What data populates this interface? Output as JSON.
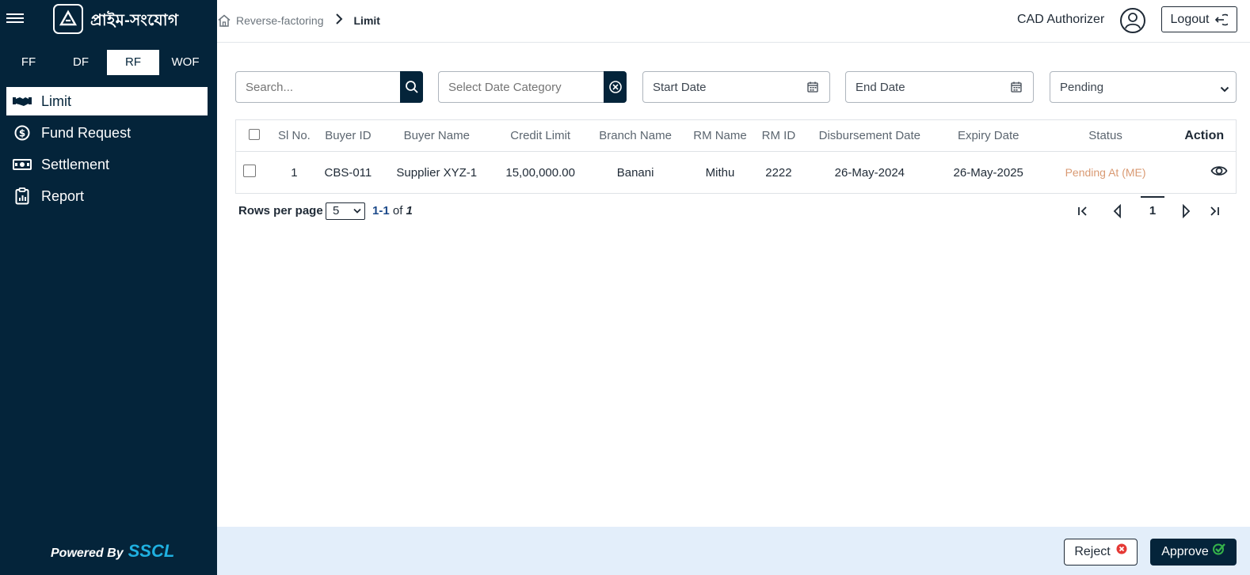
{
  "sidebar": {
    "brand": "প্রাইম-সংযোগ",
    "tabs": [
      {
        "label": "FF",
        "active": false
      },
      {
        "label": "DF",
        "active": false
      },
      {
        "label": "RF",
        "active": true
      },
      {
        "label": "WOF",
        "active": false
      }
    ],
    "nav": [
      {
        "label": "Limit",
        "icon": "handshake-icon",
        "active": true
      },
      {
        "label": "Fund Request",
        "icon": "dollar-circle-icon",
        "active": false
      },
      {
        "label": "Settlement",
        "icon": "cash-icon",
        "active": false
      },
      {
        "label": "Report",
        "icon": "clipboard-icon",
        "active": false
      }
    ],
    "powered_by": "Powered By",
    "powered_brand": "SSCL"
  },
  "header": {
    "breadcrumb": [
      "Reverse-factoring",
      "Limit"
    ],
    "user": "CAD Authorizer",
    "logout": "Logout"
  },
  "filters": {
    "search_placeholder": "Search...",
    "date_category_placeholder": "Select Date Category",
    "start_date": "Start Date",
    "end_date": "End Date",
    "status_selected": "Pending"
  },
  "table": {
    "columns": [
      "Sl No.",
      "Buyer ID",
      "Buyer Name",
      "Credit Limit",
      "Branch Name",
      "RM Name",
      "RM ID",
      "Disbursement Date",
      "Expiry Date",
      "Status",
      "Action"
    ],
    "rows": [
      {
        "sl": "1",
        "buyer_id": "CBS-011",
        "buyer_name": "Supplier XYZ-1",
        "credit_limit": "15,00,000.00",
        "branch": "Banani",
        "rm_name": "Mithu",
        "rm_id": "2222",
        "disbursement": "26-May-2024",
        "expiry": "26-May-2025",
        "status": "Pending At (ME)"
      }
    ]
  },
  "pager": {
    "rows_per_page_label": "Rows per page",
    "rows_per_page": "5",
    "range": "1-1",
    "of": "of",
    "total": "1",
    "current_page": "1"
  },
  "footer": {
    "reject": "Reject",
    "approve": "Approve"
  },
  "colors": {
    "sidebar_bg": "#04243a",
    "accent_blue": "#1fb0e0",
    "status_pending": "#d99a73",
    "footer_bg": "#e3eefa"
  }
}
